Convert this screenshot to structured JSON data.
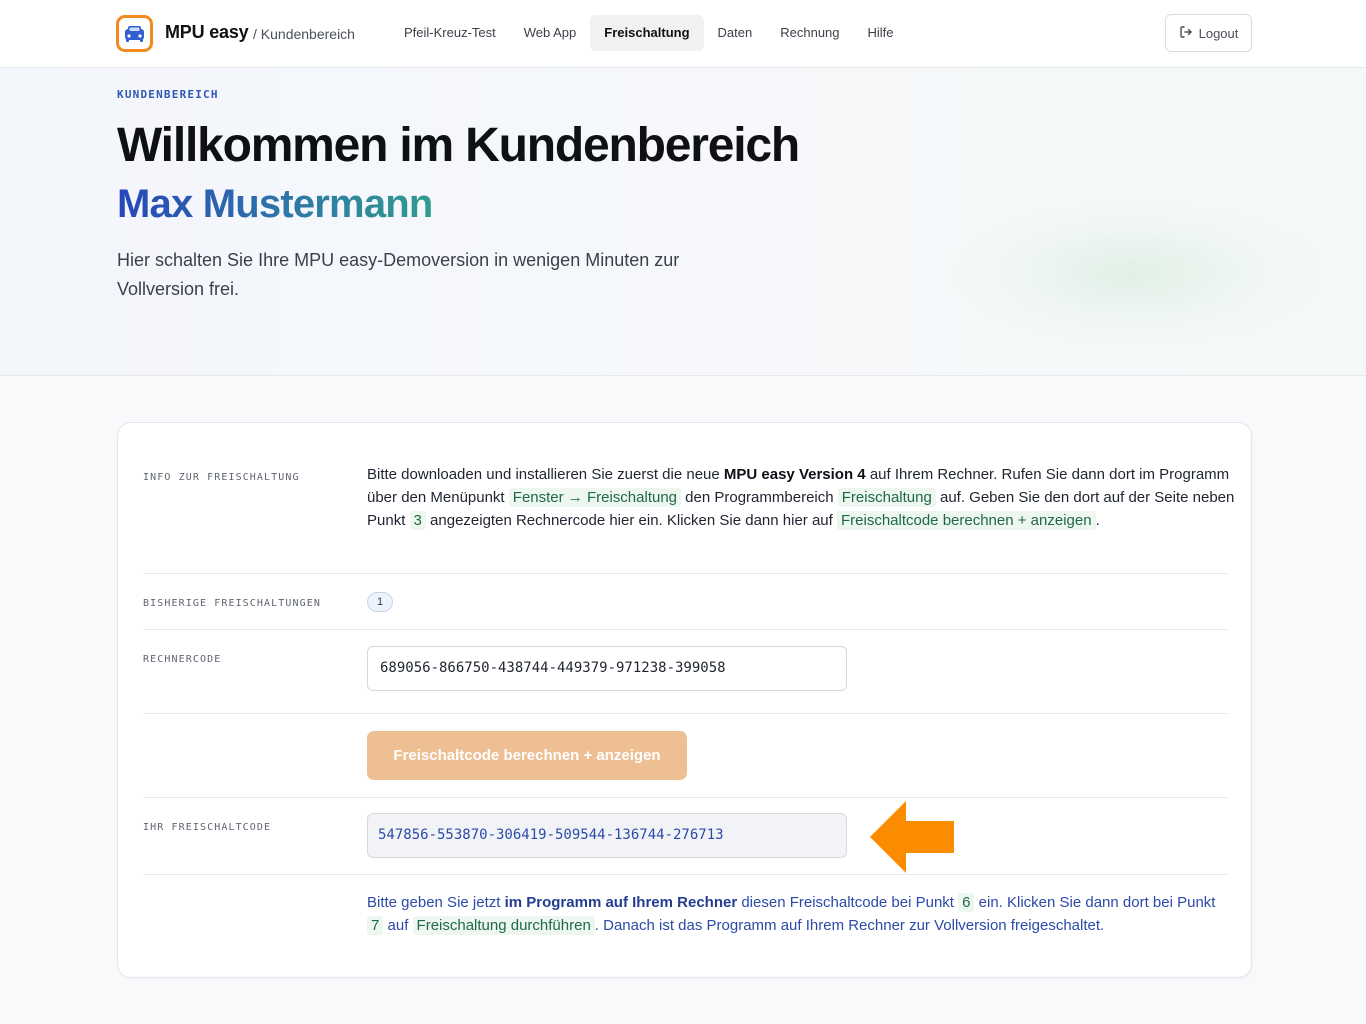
{
  "header": {
    "brand": "MPU easy",
    "brand_sub": "/ Kundenbereich",
    "nav": [
      {
        "label": "Pfeil-Kreuz-Test",
        "active": false
      },
      {
        "label": "Web App",
        "active": false
      },
      {
        "label": "Freischaltung",
        "active": true
      },
      {
        "label": "Daten",
        "active": false
      },
      {
        "label": "Rechnung",
        "active": false
      },
      {
        "label": "Hilfe",
        "active": false
      }
    ],
    "logout_label": "Logout"
  },
  "hero": {
    "eyebrow": "KUNDENBEREICH",
    "title": "Willkommen im Kundenbereich",
    "name": "Max Mustermann",
    "lead": "Hier schalten Sie Ihre MPU easy-Demoversion in wenigen Minuten zur Vollversion frei."
  },
  "card": {
    "info": {
      "label": "INFO ZUR FREISCHALTUNG",
      "t1": "Bitte downloaden und installieren Sie zuerst die neue ",
      "b1": "MPU easy Version 4",
      "t2": " auf Ihrem Rechner. Rufen Sie dann dort im Programm über den Menüpunkt ",
      "tag1": "Fenster → Freischaltung",
      "t3": " den Programmbereich ",
      "tag2": "Freischaltung",
      "t4": " auf. Geben Sie den dort auf der Seite neben Punkt ",
      "tag3": "3",
      "t5": " angezeigten Rechnercode hier ein. Klicken Sie dann hier auf ",
      "tag4": "Freischaltcode berechnen + anzeigen",
      "t6": "."
    },
    "history": {
      "label": "BISHERIGE FREISCHALTUNGEN",
      "count": "1"
    },
    "rechnercode": {
      "label": "RECHNERCODE",
      "value": "689056-866750-438744-449379-971238-399058"
    },
    "button_label": "Freischaltcode berechnen + anzeigen",
    "freischaltcode": {
      "label": "IHR FREISCHALTCODE",
      "value": "547856-553870-306419-509544-136744-276713"
    },
    "hint": {
      "t1": "Bitte geben Sie jetzt ",
      "b1": "im Programm auf Ihrem Rechner",
      "t2": " diesen Freischaltcode bei Punkt ",
      "tag1": "6",
      "t3": " ein. Klicken Sie dann dort bei Punkt ",
      "tag2": "7",
      "t4": " auf ",
      "tag3": "Freischaltung durchführen",
      "t5": ". Danach ist das Programm auf Ihrem Rechner zur Vollversion freigeschaltet."
    }
  },
  "colors": {
    "accent_orange": "#f28a1e",
    "arrow_orange": "#fb8c00",
    "button_orange_disabled": "#edbf93",
    "brand_blue": "#2c4aa8",
    "tag_green": "#1e6a46"
  },
  "icons": {
    "logo": "car-icon",
    "logout": "logout-icon",
    "pointer": "arrow-left-icon"
  }
}
